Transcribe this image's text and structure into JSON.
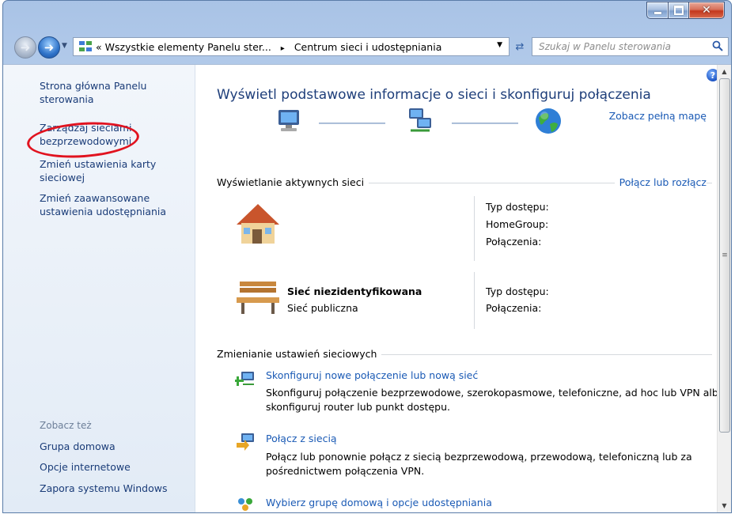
{
  "window": {
    "caption": {
      "minimize": "",
      "maximize": "",
      "close": "✕"
    }
  },
  "nav": {
    "address": {
      "prefix": "«",
      "part1": "Wszystkie elementy Panelu ster...",
      "separator": "▸",
      "part2": "Centrum sieci i udostępniania"
    },
    "search_placeholder": "Szukaj w Panelu sterowania"
  },
  "sidebar": {
    "links": [
      "Strona główna Panelu sterowania",
      "Zarządzaj sieciami bezprzewodowymi",
      "Zmień ustawienia karty sieciowej",
      "Zmień zaawansowane ustawienia udostępniania"
    ],
    "see_also_label": "Zobacz też",
    "see_also": [
      "Grupa domowa",
      "Opcje internetowe",
      "Zapora systemu Windows"
    ]
  },
  "main": {
    "title": "Wyświetl podstawowe informacje o sieci i skonfiguruj połączenia",
    "full_map_link": "Zobacz pełną mapę",
    "active_networks": {
      "label": "Wyświetlanie aktywnych sieci",
      "connect_link": "Połącz lub rozłącz",
      "networks": [
        {
          "name": "",
          "type": "",
          "props": [
            "Typ dostępu:",
            "HomeGroup:",
            "Połączenia:"
          ]
        },
        {
          "name": "Sieć niezidentyfikowana",
          "type": "Sieć publiczna",
          "props": [
            "Typ dostępu:",
            "Połączenia:"
          ]
        }
      ]
    },
    "change_settings": {
      "label": "Zmienianie ustawień sieciowych",
      "tasks": [
        {
          "link": "Skonfiguruj nowe połączenie lub nową sieć",
          "desc": "Skonfiguruj połączenie bezprzewodowe, szerokopasmowe, telefoniczne, ad hoc lub VPN albo skonfiguruj router lub punkt dostępu."
        },
        {
          "link": "Połącz z siecią",
          "desc": "Połącz lub ponownie połącz z siecią bezprzewodową, przewodową, telefoniczną lub za pośrednictwem połączenia VPN."
        },
        {
          "link": "Wybierz grupę domową i opcje udostępniania",
          "desc": ""
        }
      ]
    }
  },
  "colors": {
    "link": "#1a5ab5",
    "title": "#1e3e7a",
    "annotation": "#e1131f"
  }
}
